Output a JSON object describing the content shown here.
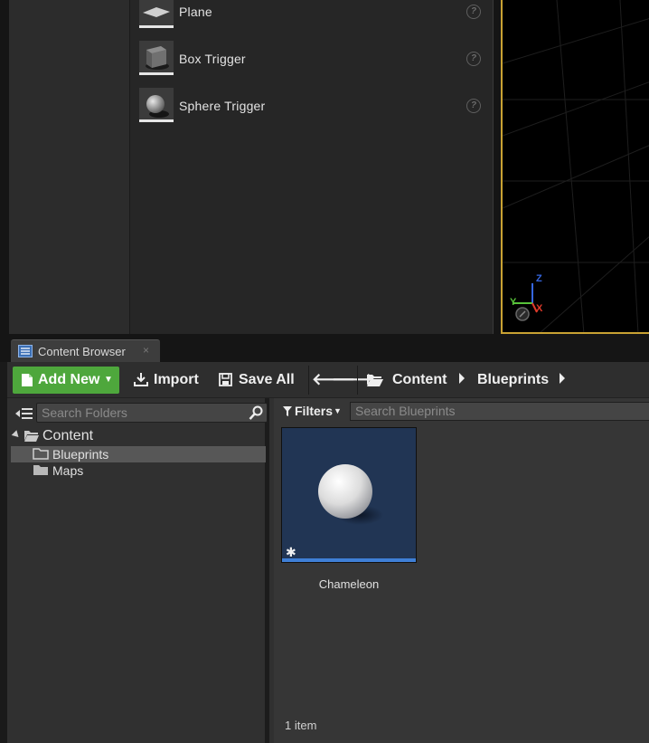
{
  "place_actors": {
    "items": [
      {
        "label": "Plane",
        "icon": "plane-icon"
      },
      {
        "label": "Box Trigger",
        "icon": "box-trigger-icon"
      },
      {
        "label": "Sphere Trigger",
        "icon": "sphere-trigger-icon"
      }
    ],
    "help_glyph": "?"
  },
  "viewport": {
    "axis_labels": {
      "x": "X",
      "y": "Y",
      "z": "Z"
    },
    "colors": {
      "x": "#e03a2a",
      "y": "#58c23a",
      "z": "#3566e0",
      "border": "#c9a233"
    }
  },
  "tab": {
    "label": "Content Browser",
    "close_glyph": "×"
  },
  "toolbar": {
    "add_new_label": "Add New",
    "import_label": "Import",
    "save_all_label": "Save All",
    "back_glyph": "🡐",
    "forward_glyph": "🡒",
    "accent_color": "#4ea73c"
  },
  "breadcrumb": {
    "items": [
      "Content",
      "Blueprints"
    ]
  },
  "folders": {
    "search_placeholder": "Search Folders",
    "tree": [
      {
        "label": "Content",
        "expanded": true
      },
      {
        "label": "Blueprints",
        "selected": true
      },
      {
        "label": "Maps"
      }
    ]
  },
  "assets": {
    "filters_label": "Filters",
    "search_placeholder": "Search Blueprints",
    "items": [
      {
        "name": "Chameleon",
        "badge": "✱"
      }
    ],
    "count_text": "1 item"
  }
}
